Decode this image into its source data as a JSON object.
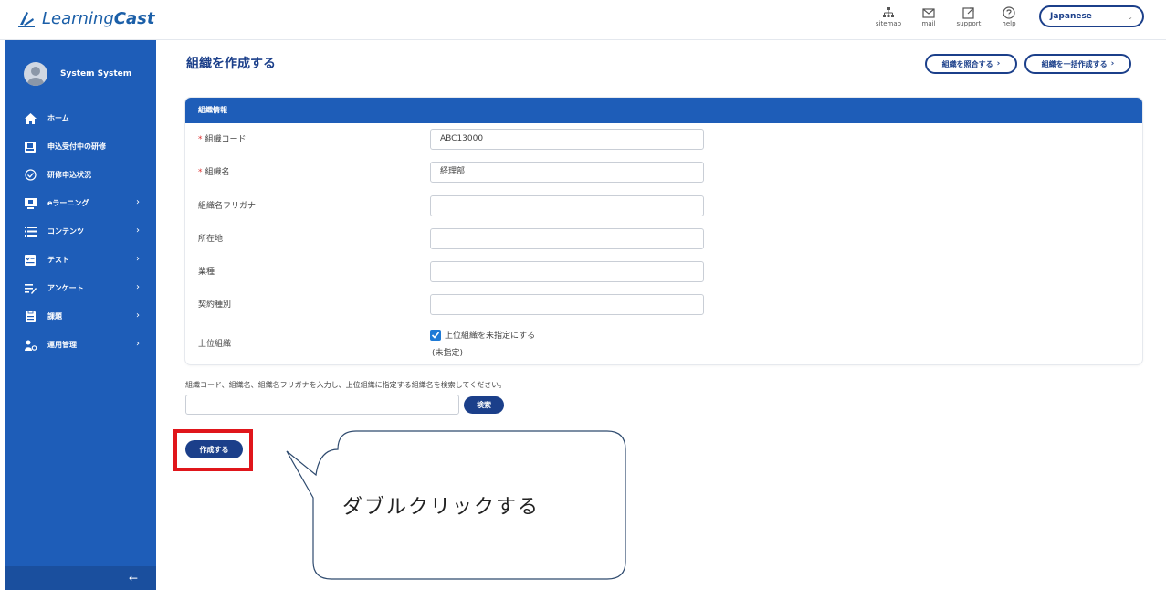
{
  "app": {
    "logo_text_prefix": "Learning",
    "logo_text_bold": "Cast"
  },
  "topbar": {
    "icons": [
      {
        "label": "sitemap",
        "icon": "sitemap-icon"
      },
      {
        "label": "mail",
        "icon": "mail-icon"
      },
      {
        "label": "support",
        "icon": "external-link-icon"
      },
      {
        "label": "help",
        "icon": "help-icon"
      }
    ],
    "language": {
      "selected": "Japanese"
    }
  },
  "sidebar": {
    "user_name": "System System",
    "items": [
      {
        "label": "ホーム",
        "icon": "home-icon",
        "has_submenu": false
      },
      {
        "label": "申込受付中の研修",
        "icon": "application-icon",
        "has_submenu": false
      },
      {
        "label": "研修申込状況",
        "icon": "status-check-icon",
        "has_submenu": false
      },
      {
        "label": "eラーニング",
        "icon": "elearning-icon",
        "has_submenu": true
      },
      {
        "label": "コンテンツ",
        "icon": "list-icon",
        "has_submenu": true
      },
      {
        "label": "テスト",
        "icon": "test-icon",
        "has_submenu": true
      },
      {
        "label": "アンケート",
        "icon": "survey-icon",
        "has_submenu": true
      },
      {
        "label": "課題",
        "icon": "assignment-icon",
        "has_submenu": true
      },
      {
        "label": "運用管理",
        "icon": "admin-icon",
        "has_submenu": true
      }
    ],
    "collapse_label": "←"
  },
  "main": {
    "title": "組織を作成する",
    "header_buttons": [
      {
        "label": "組織を照合する",
        "arrow": "›"
      },
      {
        "label": "組織を一括作成する",
        "arrow": "›"
      }
    ],
    "panel": {
      "heading": "組織情報",
      "fields": [
        {
          "label": "組織コード",
          "required": "*",
          "value": "ABC13000"
        },
        {
          "label": "組織名",
          "required": "*",
          "value": "経理部"
        },
        {
          "label": "組織名フリガナ",
          "required": "",
          "value": ""
        },
        {
          "label": "所在地",
          "required": "",
          "value": ""
        },
        {
          "label": "業種",
          "required": "",
          "value": ""
        },
        {
          "label": "契約種別",
          "required": "",
          "value": ""
        }
      ],
      "parent": {
        "label": "上位組織",
        "checkbox_label": "上位組織を未指定にする",
        "checked": true,
        "note": "(未指定)"
      }
    },
    "search": {
      "hint": "組織コード、組織名、組織名フリガナを入力し、上位組織に指定する組織名を検索してください。",
      "value": "",
      "button_label": "検索"
    },
    "create_button_label": "作成する"
  },
  "annotation": {
    "callout_text": "ダブルクリックする",
    "highlight_color": "#e0161b"
  },
  "colors": {
    "brand_blue": "#1e5db8",
    "navy": "#1b3f8a",
    "accent_check": "#1e7ad6"
  }
}
